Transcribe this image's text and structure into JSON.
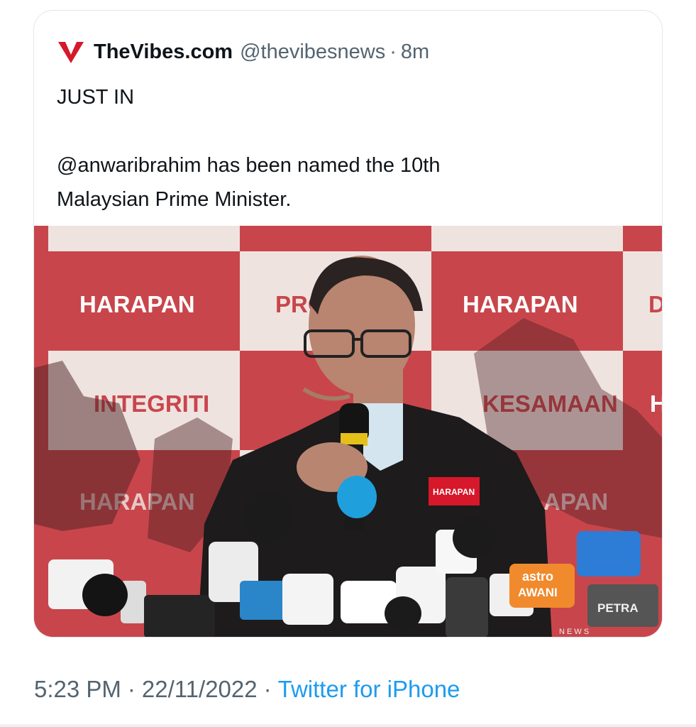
{
  "tweet": {
    "author_name": "TheVibes.com",
    "handle": "@thevibesnews",
    "separator": "·",
    "age": "8m",
    "text_line1": "JUST IN",
    "text_line2": "@anwaribrahim has been named the 10th",
    "text_line3": "Malaysian Prime Minister.",
    "logo_color": "#d6182a"
  },
  "photo": {
    "backdrop_words": {
      "harapan_left": "HARAPAN",
      "harapan_right": "HARAPAN",
      "harapan_lower_left": "HARAPAN",
      "harapan_lower_right": "APAN",
      "pro_partial": "PRO",
      "d_partial": "D",
      "integriti": "INTEGRITI",
      "kesamaan": "KESAMAAN",
      "h_partial": "H"
    },
    "badge": "HARAPAN",
    "mic_labels": {
      "astro": "astro",
      "awani": "AWANI",
      "petra": "PETRA",
      "news": "N E W S"
    },
    "backdrop_red": "#c8464b",
    "backdrop_light": "#efe3e0"
  },
  "footer": {
    "time": "5:23 PM",
    "separator": "·",
    "date": "22/11/2022",
    "separator2": "·",
    "source": "Twitter for iPhone"
  }
}
